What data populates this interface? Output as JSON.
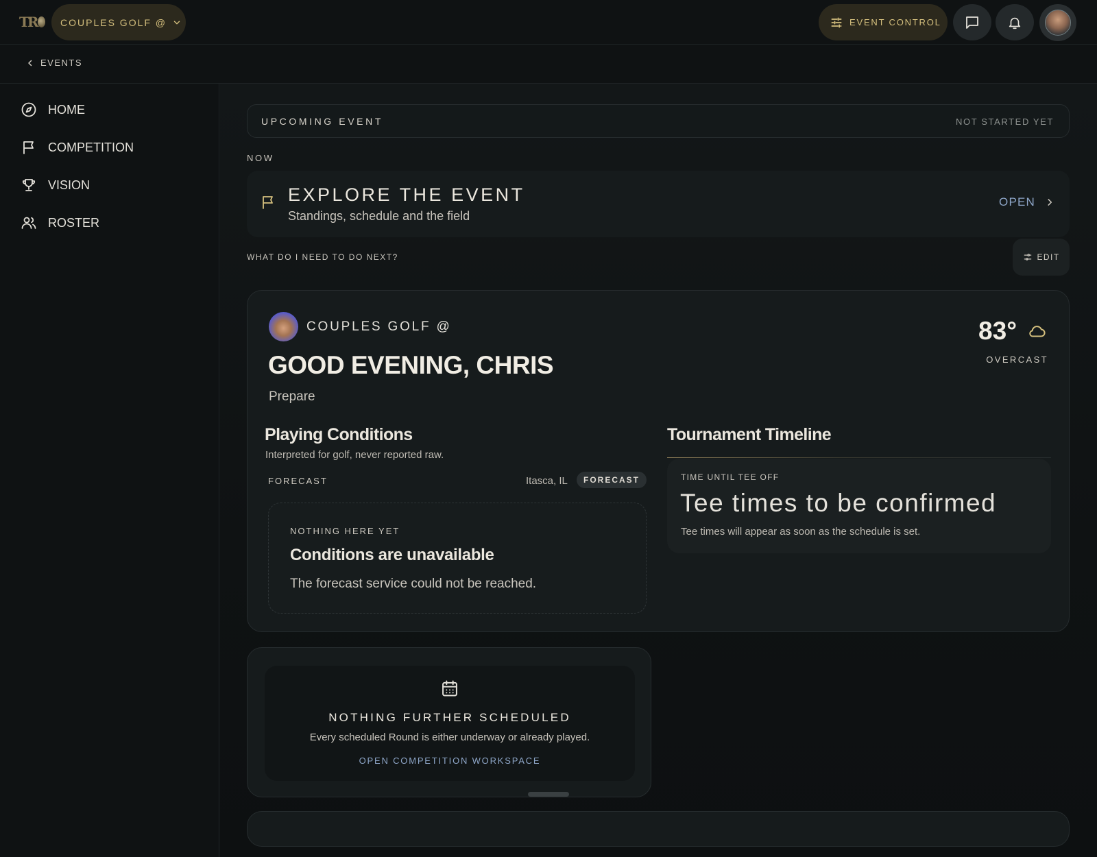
{
  "topbar": {
    "logo_text": "TR",
    "club_label": "COUPLES GOLF @",
    "event_control_label": "EVENT CONTROL",
    "icons": [
      "chevron-down-icon",
      "sliders-icon",
      "message-icon",
      "bell-icon"
    ],
    "accent_color": "#d5c07e"
  },
  "subbar": {
    "back_label": "EVENTS"
  },
  "sidebar": {
    "items": [
      {
        "label": "HOME",
        "icon": "compass-icon"
      },
      {
        "label": "COMPETITION",
        "icon": "flag-icon"
      },
      {
        "label": "VISION",
        "icon": "trophy-icon"
      },
      {
        "label": "ROSTER",
        "icon": "users-icon"
      }
    ]
  },
  "main": {
    "upcoming": {
      "label": "UPCOMING EVENT",
      "status": "NOT STARTED YET"
    },
    "now_label": "NOW",
    "explore": {
      "title": "EXPLORE THE EVENT",
      "subtitle": "Standings, schedule and the field",
      "open_label": "OPEN"
    },
    "next_label": "WHAT DO I NEED TO DO NEXT?",
    "edit_label": "EDIT",
    "greeting_card": {
      "club": "COUPLES GOLF @",
      "greeting": "GOOD EVENING, CHRIS",
      "status": "Prepare",
      "temperature": "83°",
      "condition": "OVERCAST",
      "playing_conditions": {
        "title": "Playing Conditions",
        "subtitle": "Interpreted for golf, never reported raw.",
        "forecast_label": "FORECAST",
        "location": "Itasca, IL",
        "badge": "FORECAST",
        "empty_kicker": "NOTHING HERE YET",
        "empty_title": "Conditions are unavailable",
        "empty_text": "The forecast service could not be reached."
      },
      "timeline": {
        "title": "Tournament Timeline",
        "kicker": "TIME UNTIL TEE OFF",
        "headline": "Tee times to be confirmed",
        "text": "Tee times will appear as soon as the schedule is set."
      }
    },
    "schedule_card": {
      "title": "NOTHING FURTHER SCHEDULED",
      "text": "Every scheduled Round is either underway or already played.",
      "link": "OPEN COMPETITION WORKSPACE"
    },
    "link_color": "#8ea6c8"
  }
}
